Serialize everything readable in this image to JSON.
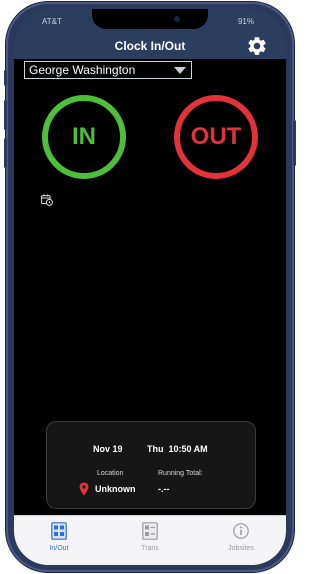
{
  "status_bar": {
    "carrier": "AT&T",
    "battery": "91%"
  },
  "nav": {
    "title": "Clock In/Out",
    "settings_icon": "gear-icon"
  },
  "employee": {
    "selected": "George Washington"
  },
  "buttons": {
    "in_label": "IN",
    "out_label": "OUT",
    "in_color": "#4fbe3a",
    "out_color": "#e2323a"
  },
  "history_icon": "calendar-clock-icon",
  "info_card": {
    "date": "Nov 19",
    "day_time": "Thu  10:50 AM",
    "location_label": "Location",
    "location_value": "Unknown",
    "running_total_label": "Running Total:",
    "running_total_value": "-.--",
    "pin_color": "#e2323a"
  },
  "tabs": [
    {
      "label": "In/Out",
      "icon": "clock-card-icon",
      "active": true
    },
    {
      "label": "Trans",
      "icon": "list-card-icon",
      "active": false
    },
    {
      "label": "Jobsites",
      "icon": "info-icon",
      "active": false
    }
  ],
  "colors": {
    "nav_background": "#2c3e5e",
    "active_tab": "#2f6fd6",
    "inactive_tab": "#9a9aa2"
  }
}
